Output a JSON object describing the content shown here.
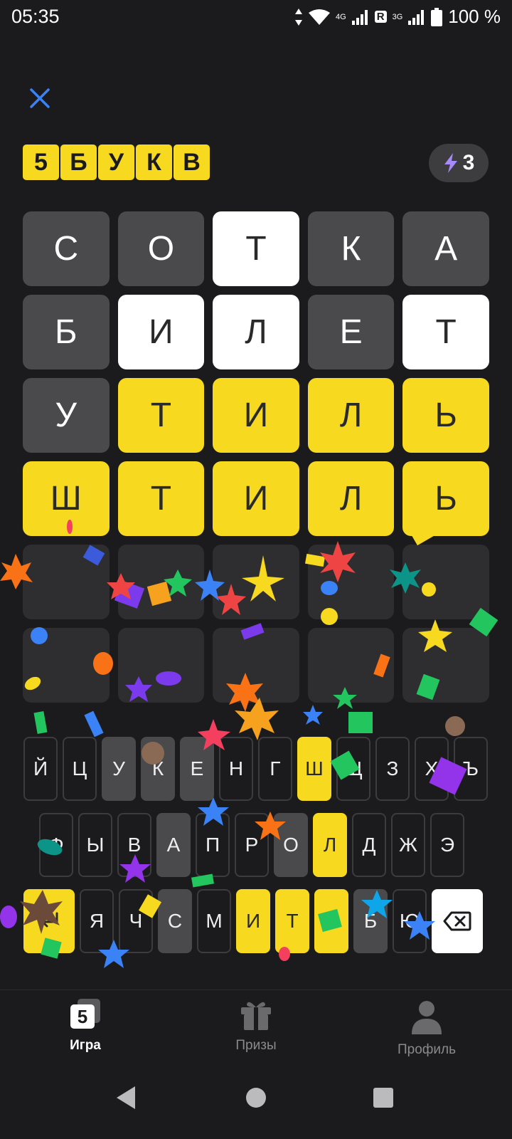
{
  "status_bar": {
    "time": "05:35",
    "network_1": "4G",
    "roaming": "R",
    "network_2": "3G",
    "battery": "100 %"
  },
  "header": {
    "close_icon": "close-icon",
    "logo_letters": [
      "5",
      "Б",
      "У",
      "К",
      "В"
    ],
    "energy_count": "3",
    "energy_icon": "lightning-icon"
  },
  "colors": {
    "yellow": "#f7da1f",
    "gray": "#4a4a4c",
    "white": "#ffffff",
    "empty": "#2e2e30",
    "background": "#1b1b1d"
  },
  "grid": {
    "rows": [
      [
        {
          "letter": "С",
          "state": "gray"
        },
        {
          "letter": "О",
          "state": "gray"
        },
        {
          "letter": "Т",
          "state": "white"
        },
        {
          "letter": "К",
          "state": "gray"
        },
        {
          "letter": "А",
          "state": "gray"
        }
      ],
      [
        {
          "letter": "Б",
          "state": "gray"
        },
        {
          "letter": "И",
          "state": "white"
        },
        {
          "letter": "Л",
          "state": "white"
        },
        {
          "letter": "Е",
          "state": "gray"
        },
        {
          "letter": "Т",
          "state": "white"
        }
      ],
      [
        {
          "letter": "У",
          "state": "gray"
        },
        {
          "letter": "Т",
          "state": "yellow"
        },
        {
          "letter": "И",
          "state": "yellow"
        },
        {
          "letter": "Л",
          "state": "yellow"
        },
        {
          "letter": "Ь",
          "state": "yellow"
        }
      ],
      [
        {
          "letter": "Ш",
          "state": "yellow"
        },
        {
          "letter": "Т",
          "state": "yellow"
        },
        {
          "letter": "И",
          "state": "yellow"
        },
        {
          "letter": "Л",
          "state": "yellow"
        },
        {
          "letter": "Ь",
          "state": "yellow"
        }
      ],
      [
        {
          "letter": "",
          "state": "empty"
        },
        {
          "letter": "",
          "state": "empty"
        },
        {
          "letter": "",
          "state": "empty"
        },
        {
          "letter": "",
          "state": "empty"
        },
        {
          "letter": "",
          "state": "empty"
        }
      ],
      [
        {
          "letter": "",
          "state": "empty"
        },
        {
          "letter": "",
          "state": "empty"
        },
        {
          "letter": "",
          "state": "empty"
        },
        {
          "letter": "",
          "state": "empty"
        },
        {
          "letter": "",
          "state": "empty"
        }
      ]
    ]
  },
  "keyboard": {
    "row1": [
      {
        "k": "Й",
        "s": "default"
      },
      {
        "k": "Ц",
        "s": "default"
      },
      {
        "k": "У",
        "s": "gray"
      },
      {
        "k": "К",
        "s": "gray"
      },
      {
        "k": "Е",
        "s": "gray"
      },
      {
        "k": "Н",
        "s": "default"
      },
      {
        "k": "Г",
        "s": "default"
      },
      {
        "k": "Ш",
        "s": "yellow"
      },
      {
        "k": "Щ",
        "s": "default"
      },
      {
        "k": "З",
        "s": "default"
      },
      {
        "k": "Х",
        "s": "default"
      },
      {
        "k": "Ъ",
        "s": "default"
      }
    ],
    "row2": [
      {
        "k": "Ф",
        "s": "default"
      },
      {
        "k": "Ы",
        "s": "default"
      },
      {
        "k": "В",
        "s": "default"
      },
      {
        "k": "А",
        "s": "gray"
      },
      {
        "k": "П",
        "s": "default"
      },
      {
        "k": "Р",
        "s": "default"
      },
      {
        "k": "О",
        "s": "gray"
      },
      {
        "k": "Л",
        "s": "yellow"
      },
      {
        "k": "Д",
        "s": "default"
      },
      {
        "k": "Ж",
        "s": "default"
      },
      {
        "k": "Э",
        "s": "default"
      }
    ],
    "row3": [
      {
        "k": "Я",
        "s": "default"
      },
      {
        "k": "Ч",
        "s": "default"
      },
      {
        "k": "С",
        "s": "gray"
      },
      {
        "k": "М",
        "s": "default"
      },
      {
        "k": "И",
        "s": "yellow"
      },
      {
        "k": "Т",
        "s": "yellow"
      },
      {
        "k": "Ь",
        "s": "yellow"
      },
      {
        "k": "Б",
        "s": "gray"
      },
      {
        "k": "Ю",
        "s": "default"
      }
    ],
    "enter_icon": "enter-icon",
    "backspace_icon": "backspace-icon"
  },
  "bottom_nav": [
    {
      "label": "Игра",
      "icon": "game-icon",
      "active": true
    },
    {
      "label": "Призы",
      "icon": "gift-icon",
      "active": false
    },
    {
      "label": "Профиль",
      "icon": "profile-icon",
      "active": false
    }
  ],
  "system_nav": {
    "back_icon": "back-icon",
    "home_icon": "home-icon",
    "recents_icon": "recents-icon"
  }
}
